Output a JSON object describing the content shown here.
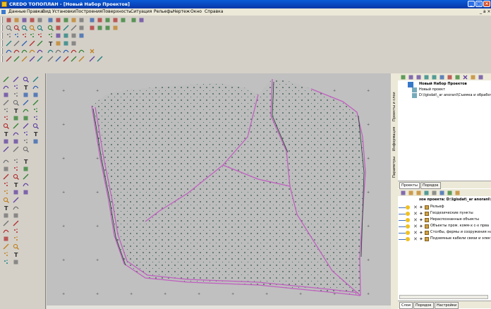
{
  "window": {
    "title": "CREDO ТОПОПЛАН - [Новый Набор Проектов]",
    "minimize": "_",
    "maximize": "□",
    "close": "×",
    "doc_controls": "_ a ×"
  },
  "menu": [
    "Данные",
    "Правка",
    "Вид",
    "Установки",
    "Построения",
    "Поверхность",
    "Ситуация",
    "Рельефы",
    "Чертеж",
    "Окно",
    "Справка"
  ],
  "toolbar_icons": {
    "row1": [
      "new-icon",
      "open-icon",
      "save-icon",
      "save-as-icon",
      "tool-icon",
      "tool-icon",
      "edit-icon",
      "undo-icon",
      "redo-icon",
      "filter-icon",
      "filter-icon",
      "filter-icon",
      "filter-icon",
      "rect-icon",
      "rect-icon",
      "binoculars-icon",
      "help-icon"
    ],
    "row2": [
      "zoom-in-icon",
      "zoom-out-icon",
      "zoom-window-icon",
      "zoom-all-icon",
      "zoom-prev-icon",
      "zoom-extents-icon",
      "pan-icon",
      "arrows-icon",
      "arrows-icon",
      "scale-icon",
      "filter-icon",
      "rotate-icon",
      "chart-icon",
      "check-icon"
    ],
    "row3": [
      "points-icon",
      "points-icon",
      "points-icon",
      "points-icon",
      "node-icon",
      "node-icon",
      "layer-icon",
      "layer-icon",
      "layer-icon",
      "layer-icon"
    ],
    "row4": [
      "line-icon",
      "line-icon",
      "line-icon",
      "line-icon",
      "line-icon",
      "text-icon",
      "box-icon",
      "edit-icon",
      "edit-icon"
    ],
    "row5": [
      "curve-icon",
      "curve-icon",
      "curve-icon",
      "curve-icon",
      "curve-icon",
      "curve-icon",
      "curve-icon",
      "curve-icon",
      "curve-icon",
      "curve-icon",
      "close-icon"
    ],
    "row6": [
      "arrow-icon",
      "arrow-icon",
      "arrow-icon",
      "arrow-icon",
      "arrow-icon",
      "arrow-icon",
      "arrow-icon",
      "arrow-icon",
      "arrow-icon",
      "arrow-icon",
      "arrow-icon",
      "arrow-icon"
    ]
  },
  "side_tabs": [
    "Проекты и слои",
    "Информация",
    "Параметры"
  ],
  "projects": {
    "root": "Новый Набор Проектов",
    "items": [
      "Новый проект",
      "D:\\Igisdat\\_ar anoranl\\Съемка и обработ"
    ]
  },
  "panel_tabs": [
    "Проекты",
    "Порядок"
  ],
  "layers_header": "зон проекта: D:\\Igisdat\\_ar anoranl\\С",
  "layers": [
    "Рельеф",
    "Геодезические пункты",
    "Нераспознанные объекты",
    "Объекты пром. комм-х с-х прва",
    "Столбы, фермы и сооружения на нио",
    "Подземные кабели связи и электрическо"
  ],
  "bottom_tabs": [
    "Слои",
    "Порядок",
    "Настройки"
  ],
  "colors": {
    "canvas": "#c0c0c0",
    "terrain_fill": "#bdbdbd",
    "outline": "#c060c0",
    "points": "#2a5040",
    "titlebar": "#0a5bd8"
  }
}
